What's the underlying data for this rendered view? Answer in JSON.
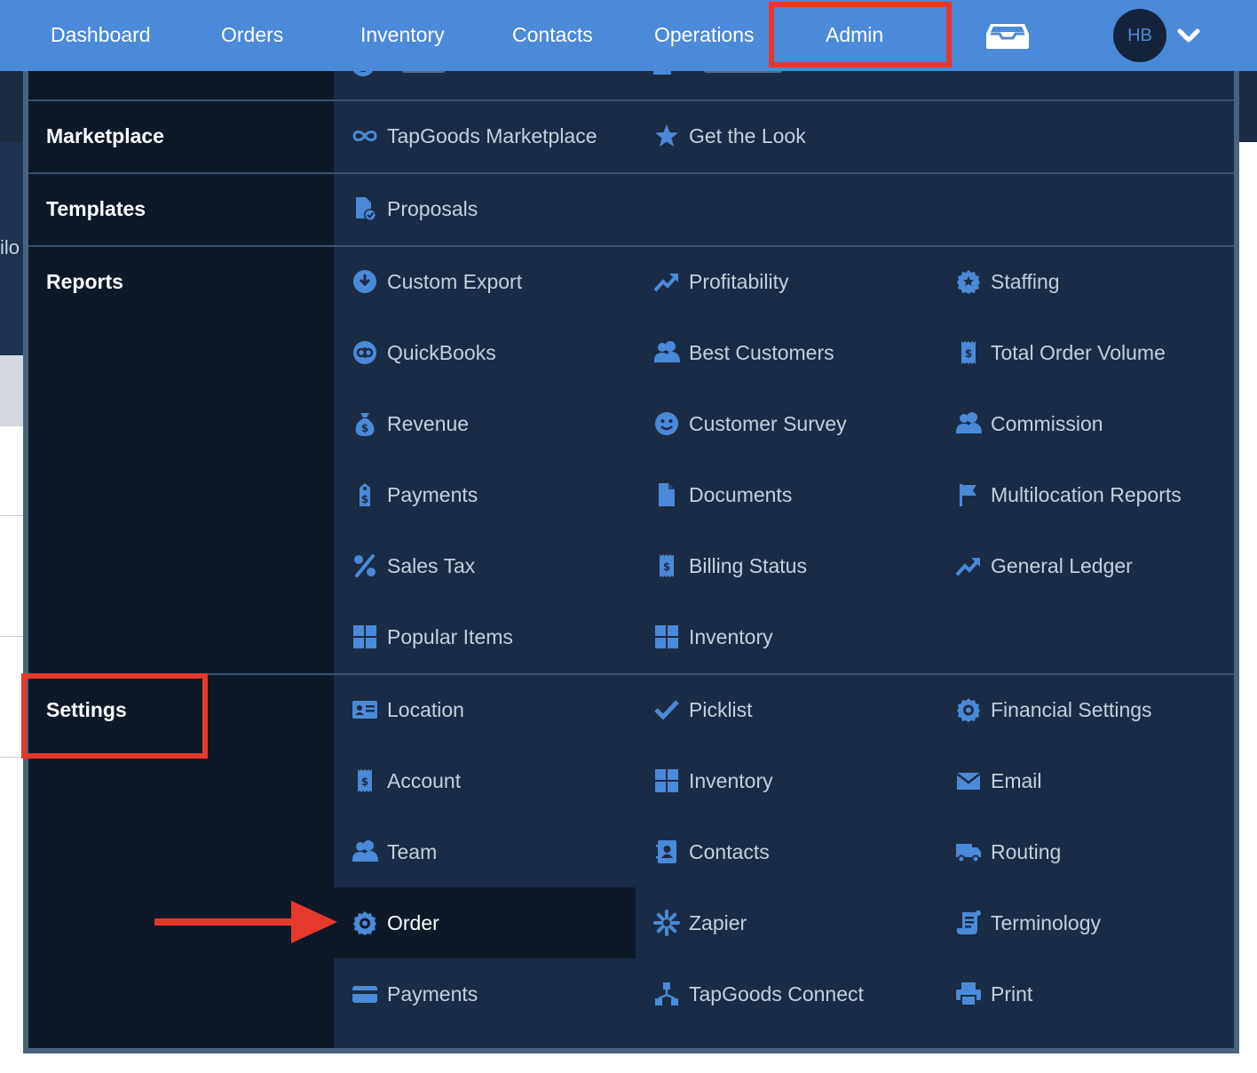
{
  "nav": {
    "items": [
      "Dashboard",
      "Orders",
      "Inventory",
      "Contacts",
      "Operations",
      "Admin"
    ],
    "avatar_initials": "HB",
    "icons": {
      "inbox": "inbox-icon",
      "chevron": "chevron-down-icon"
    }
  },
  "background": {
    "partial_text": "ilo"
  },
  "menu": {
    "marketplace": {
      "label": "Marketplace",
      "items": [
        {
          "label": "TapGoods Marketplace",
          "icon": "infinity-icon"
        },
        {
          "label": "Get the Look",
          "icon": "star-icon"
        }
      ]
    },
    "templates": {
      "label": "Templates",
      "items": [
        {
          "label": "Proposals",
          "icon": "file-check-icon"
        }
      ]
    },
    "reports": {
      "label": "Reports",
      "items": [
        {
          "label": "Custom Export",
          "icon": "download-circle-icon"
        },
        {
          "label": "Profitability",
          "icon": "trend-up-icon"
        },
        {
          "label": "Staffing",
          "icon": "gear-badge-icon"
        },
        {
          "label": "QuickBooks",
          "icon": "quickbooks-icon"
        },
        {
          "label": "Best Customers",
          "icon": "users-icon"
        },
        {
          "label": "Total Order Volume",
          "icon": "receipt-icon"
        },
        {
          "label": "Revenue",
          "icon": "money-bag-icon"
        },
        {
          "label": "Customer Survey",
          "icon": "smile-icon"
        },
        {
          "label": "Commission",
          "icon": "users-icon"
        },
        {
          "label": "Payments",
          "icon": "price-tag-icon"
        },
        {
          "label": "Documents",
          "icon": "file-icon"
        },
        {
          "label": "Multilocation Reports",
          "icon": "flag-icon"
        },
        {
          "label": "Sales Tax",
          "icon": "percent-icon"
        },
        {
          "label": "Billing Status",
          "icon": "receipt-icon"
        },
        {
          "label": "General Ledger",
          "icon": "trend-up-icon"
        },
        {
          "label": "Popular Items",
          "icon": "grid-icon"
        },
        {
          "label": "Inventory",
          "icon": "grid-icon"
        }
      ]
    },
    "settings": {
      "label": "Settings",
      "items": [
        {
          "label": "Location",
          "icon": "id-card-icon"
        },
        {
          "label": "Picklist",
          "icon": "check-icon"
        },
        {
          "label": "Financial Settings",
          "icon": "gear-badge-icon"
        },
        {
          "label": "Account",
          "icon": "receipt-icon"
        },
        {
          "label": "Inventory",
          "icon": "grid-icon"
        },
        {
          "label": "Email",
          "icon": "envelope-icon"
        },
        {
          "label": "Team",
          "icon": "users-icon"
        },
        {
          "label": "Contacts",
          "icon": "contact-book-icon"
        },
        {
          "label": "Routing",
          "icon": "truck-icon"
        },
        {
          "label": "Order",
          "icon": "gear-badge-icon"
        },
        {
          "label": "Zapier",
          "icon": "asterisk-icon"
        },
        {
          "label": "Terminology",
          "icon": "scroll-icon"
        },
        {
          "label": "Payments",
          "icon": "credit-card-icon"
        },
        {
          "label": "TapGoods Connect",
          "icon": "network-icon"
        },
        {
          "label": "Print",
          "icon": "printer-icon"
        }
      ]
    }
  },
  "colors": {
    "nav_bg": "#4a8ad8",
    "panel_left": "#0e1928",
    "panel_right": "#1a2b45",
    "icon": "#4a8ad8",
    "highlight": "#e53a2b"
  }
}
